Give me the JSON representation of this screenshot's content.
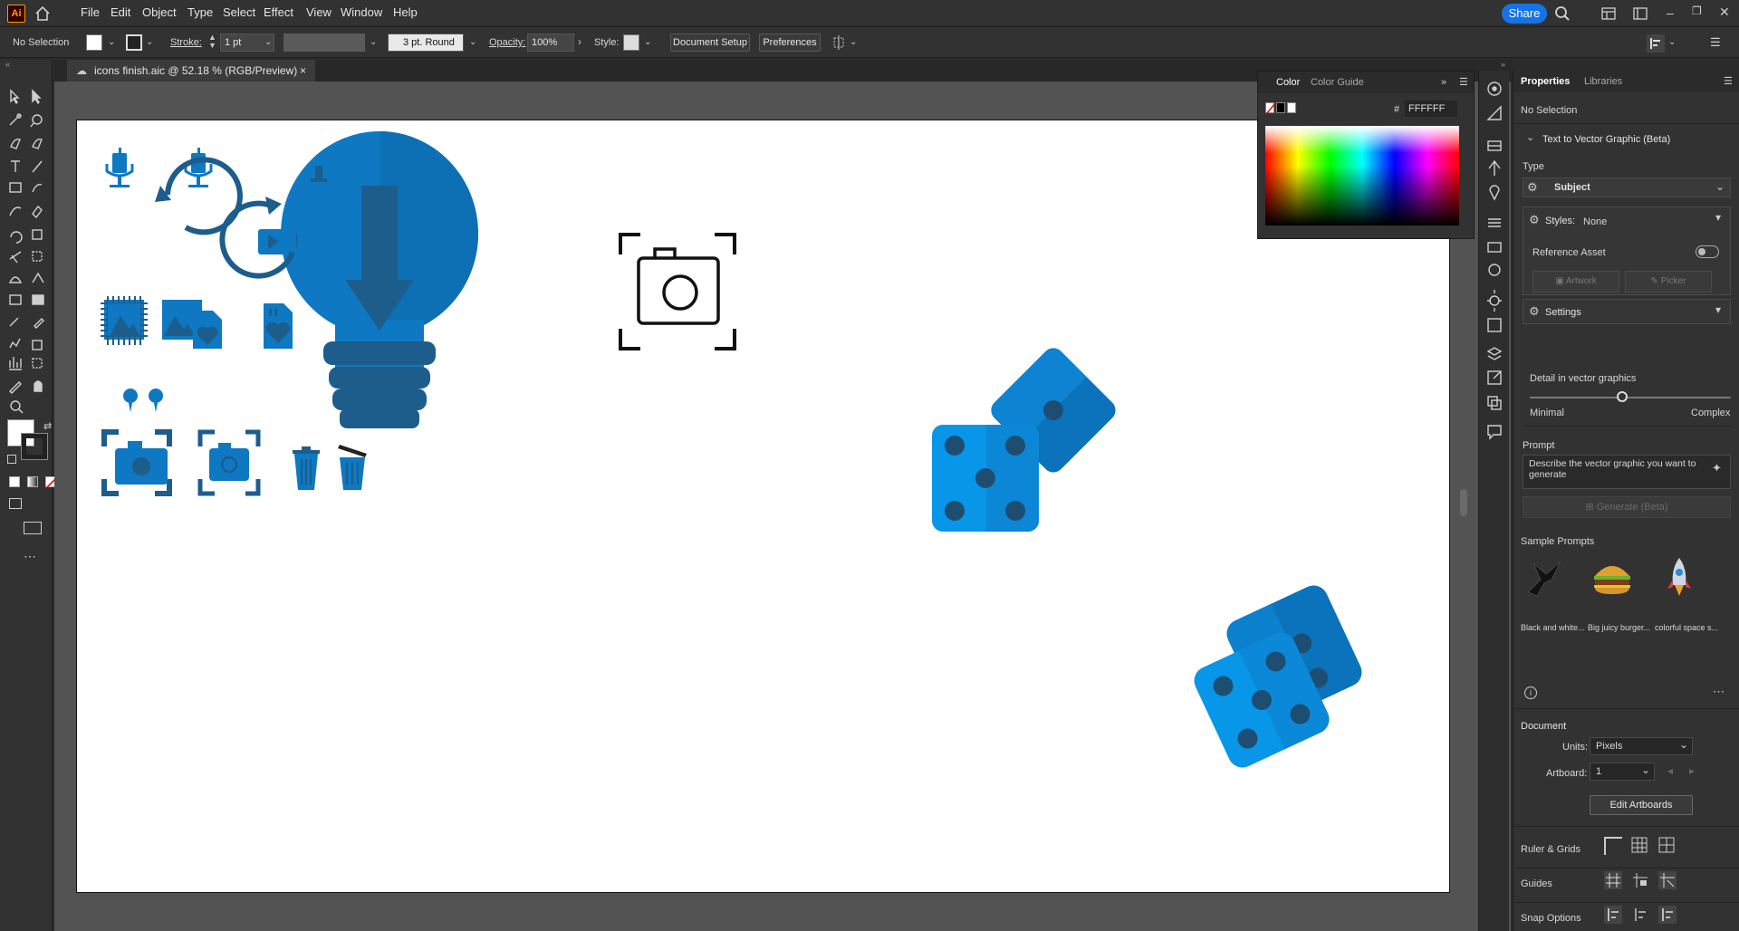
{
  "app": {
    "logo_text": "Ai"
  },
  "menu": {
    "items": [
      "File",
      "Edit",
      "Object",
      "Type",
      "Select",
      "Effect",
      "View",
      "Window",
      "Help"
    ],
    "share_label": "Share"
  },
  "control_bar": {
    "selection_status": "No Selection",
    "stroke_label": "Stroke:",
    "stroke_weight": "1 pt",
    "brush_profile": "3 pt. Round",
    "opacity_label": "Opacity:",
    "opacity_value": "100%",
    "style_label": "Style:",
    "document_setup_label": "Document Setup",
    "preferences_label": "Preferences"
  },
  "document_tab": {
    "title": "icons finish.aic @ 52.18 % (RGB/Preview)",
    "close": "×"
  },
  "color_panel": {
    "tabs": [
      "Color",
      "Color Guide"
    ],
    "hex_label": "#",
    "hex_value": "FFFFFF"
  },
  "properties": {
    "tabs": [
      "Properties",
      "Libraries"
    ],
    "selection": "No Selection",
    "text_to_vector": {
      "title": "Text to Vector Graphic (Beta)",
      "type_label": "Type",
      "type_value": "Subject",
      "styles_label": "Styles:",
      "styles_value": "None",
      "reference_asset_label": "Reference Asset",
      "artwork_label": "Artwork",
      "picker_label": "Picker",
      "settings_label": "Settings",
      "detail_label": "Detail in vector graphics",
      "detail_min": "Minimal",
      "detail_max": "Complex",
      "detail_level": 0.46,
      "prompt_label": "Prompt",
      "prompt_placeholder": "Describe the vector graphic you want to generate",
      "generate_label": "Generate (Beta)",
      "sample_prompts_label": "Sample Prompts",
      "samples": [
        "Black and white...",
        "Big juicy burger...",
        "colorful space s..."
      ]
    },
    "document": {
      "title": "Document",
      "units_label": "Units:",
      "units_value": "Pixels",
      "artboard_label": "Artboard:",
      "artboard_value": "1",
      "edit_artboards_label": "Edit Artboards",
      "ruler_grids_label": "Ruler & Grids",
      "guides_label": "Guides",
      "snap_options_label": "Snap Options"
    }
  },
  "colors": {
    "accent": "#1473e6",
    "icon_blue": "#0e78c2",
    "icon_dark": "#1d5d8c",
    "dice_light": "#0796e8",
    "dice_dark": "#0b73bb"
  }
}
